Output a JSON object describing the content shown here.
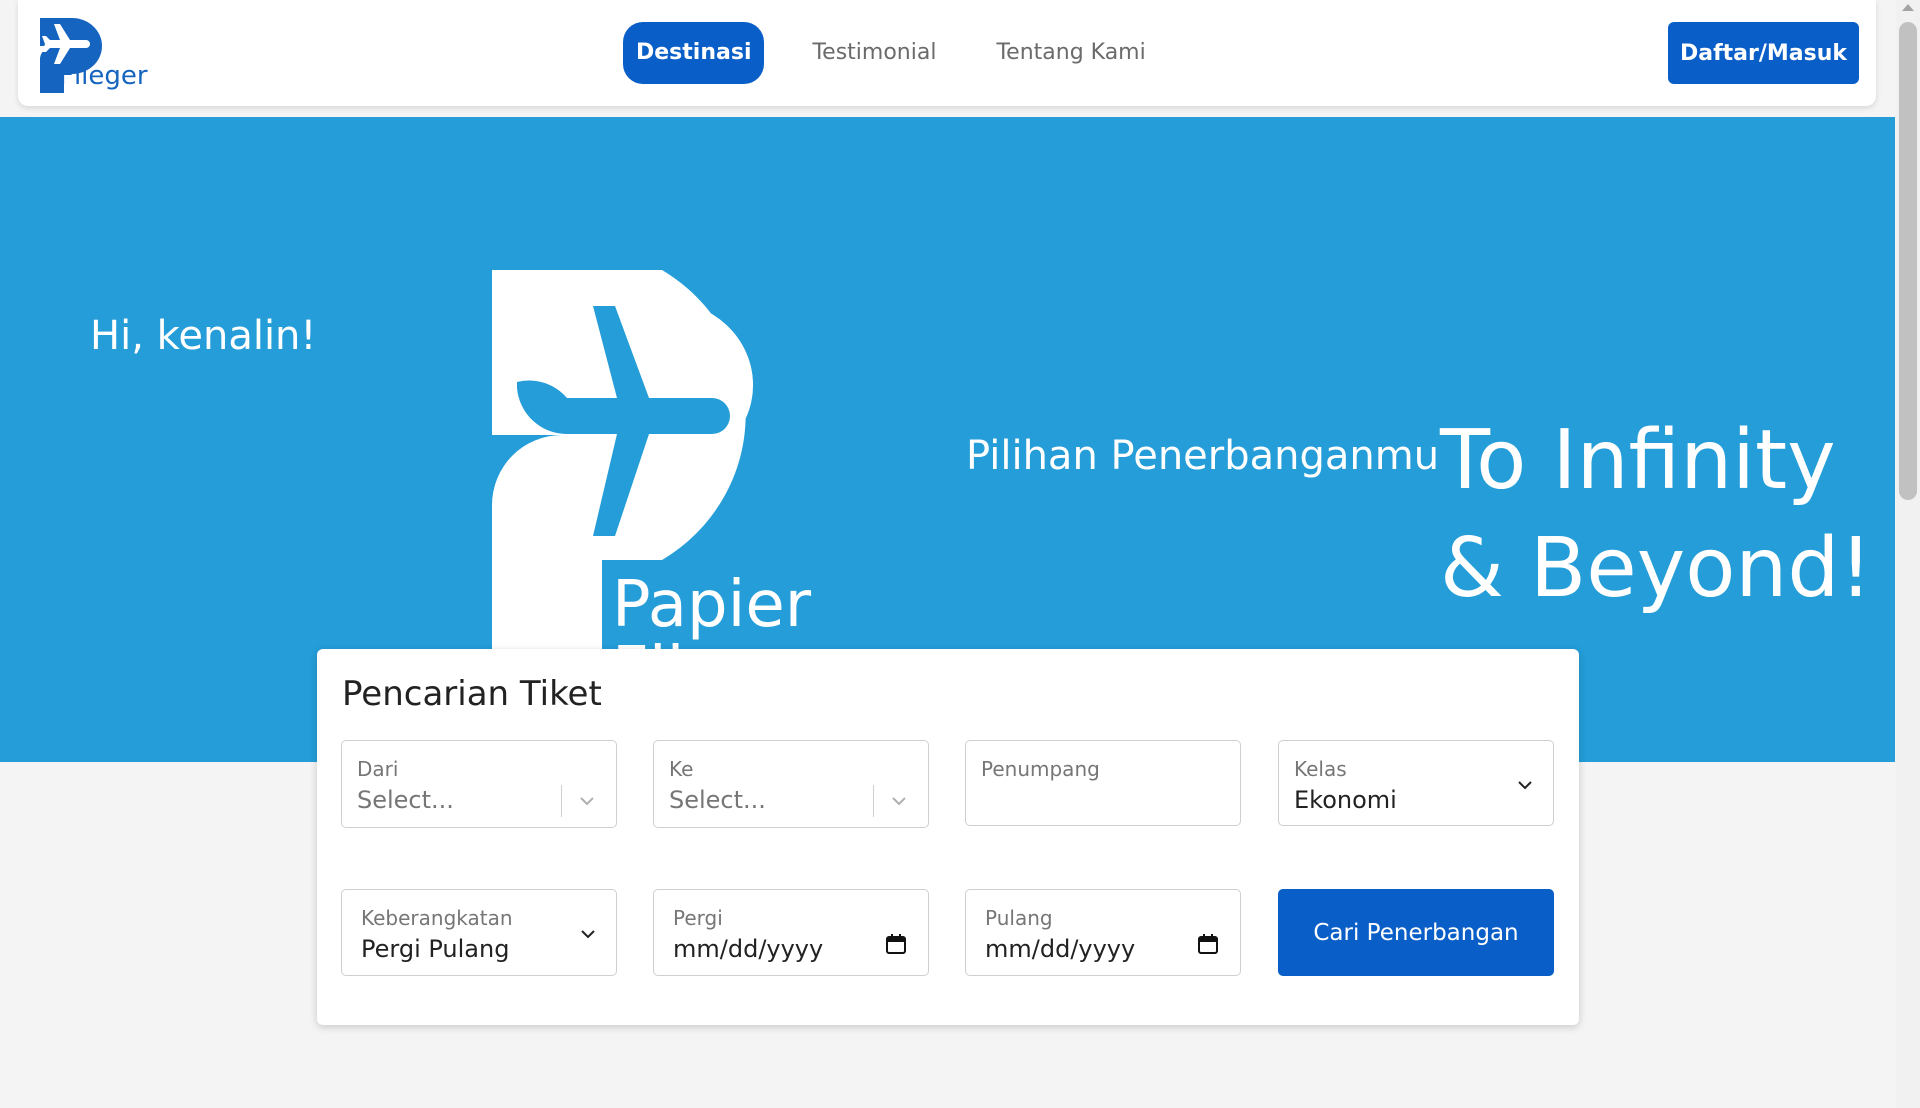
{
  "nav": {
    "logo_text": "Flieger",
    "links": [
      {
        "label": "Destinasi",
        "active": true
      },
      {
        "label": "Testimonial",
        "active": false
      },
      {
        "label": "Tentang Kami",
        "active": false
      }
    ],
    "cta_label": "Daftar/Masuk"
  },
  "hero": {
    "greeting": "Hi, kenalin!",
    "brand_line1": "Papier",
    "brand_line2": "Flieger",
    "subtitle": "Pilihan Penerbanganmu",
    "title_line1": "To Infinity",
    "title_line2": "& Beyond!"
  },
  "search": {
    "title": "Pencarian Tiket",
    "from": {
      "label": "Dari",
      "placeholder": "Select..."
    },
    "to": {
      "label": "Ke",
      "placeholder": "Select..."
    },
    "passengers": {
      "label": "Penumpang",
      "value": ""
    },
    "class": {
      "label": "Kelas",
      "value": "Ekonomi"
    },
    "trip_type": {
      "label": "Keberangkatan",
      "value": "Pergi Pulang"
    },
    "depart": {
      "label": "Pergi",
      "value": "mm/dd/yyyy"
    },
    "return": {
      "label": "Pulang",
      "value": "mm/dd/yyyy"
    },
    "submit_label": "Cari Penerbangan"
  },
  "colors": {
    "brand_blue": "#0a5ec7",
    "hero_blue": "#249dd9",
    "page_bg": "#f4f4f4"
  },
  "icons": [
    "plane-logo-icon",
    "chevron-down-icon",
    "calendar-icon"
  ]
}
